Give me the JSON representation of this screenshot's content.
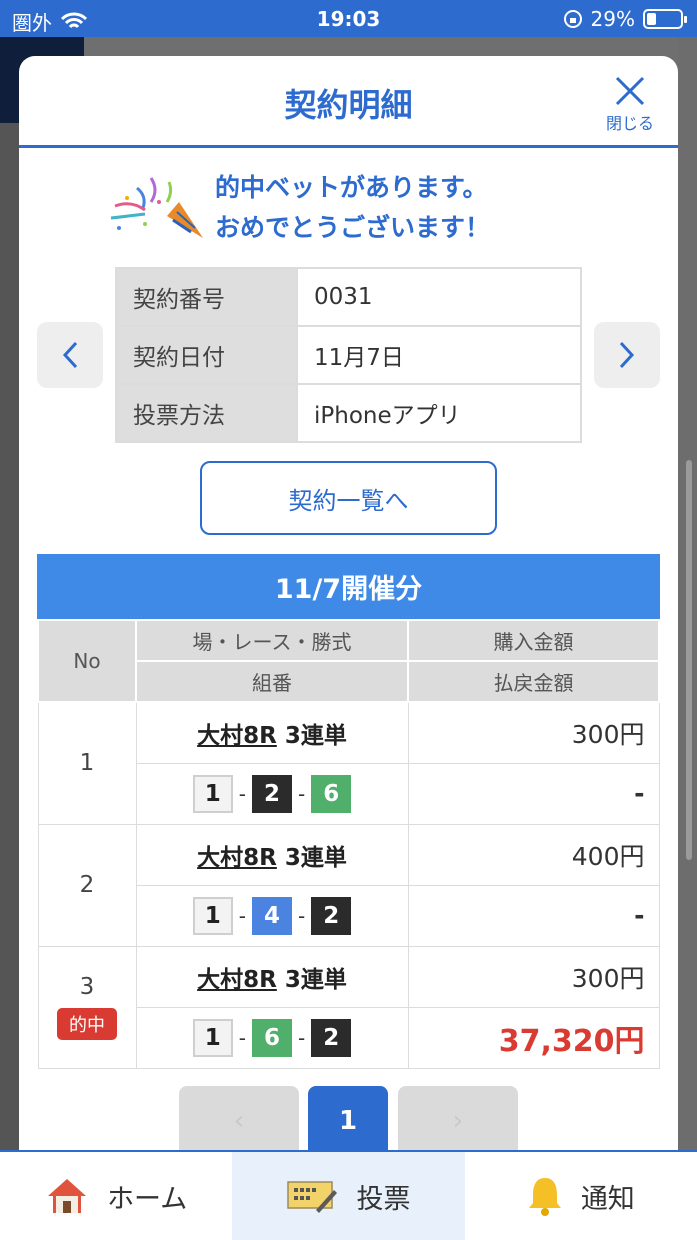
{
  "status_bar": {
    "carrier": "圏外",
    "time": "19:03",
    "battery": "29%",
    "battery_level": 0.29
  },
  "modal": {
    "title": "契約明細",
    "close_label": "閉じる"
  },
  "congrats": {
    "line1": "的中ベットがあります。",
    "line2": "おめでとうございます！"
  },
  "contract": [
    {
      "label": "契約番号",
      "value": "0031"
    },
    {
      "label": "契約日付",
      "value": "11月7日"
    },
    {
      "label": "投票方法",
      "value": "iPhoneアプリ"
    }
  ],
  "list_button": "契約一覧へ",
  "section_title": "11/7開催分",
  "table_headers": {
    "no": "No",
    "race": "場・レース・勝式",
    "combo": "組番",
    "purchase": "購入金額",
    "payout": "払戻金額"
  },
  "bets": [
    {
      "no": "1",
      "venue": "大村8R",
      "type": "3連単",
      "combo": [
        "1",
        "2",
        "6"
      ],
      "amount": "300円",
      "payout": "-",
      "hit": ""
    },
    {
      "no": "2",
      "venue": "大村8R",
      "type": "3連単",
      "combo": [
        "1",
        "4",
        "2"
      ],
      "amount": "400円",
      "payout": "-",
      "hit": ""
    },
    {
      "no": "3",
      "venue": "大村8R",
      "type": "3連単",
      "combo": [
        "1",
        "6",
        "2"
      ],
      "amount": "300円",
      "payout": "37,320円",
      "hit": "的中"
    }
  ],
  "pagination": {
    "prev": "‹",
    "current": "1",
    "next": "›"
  },
  "tabbar": [
    {
      "label": "ホーム",
      "icon": "home-icon"
    },
    {
      "label": "投票",
      "icon": "ticket-icon"
    },
    {
      "label": "通知",
      "icon": "bell-icon"
    }
  ],
  "colors": {
    "primary": "#2d6bcf",
    "section": "#3e8ae6",
    "win": "#d93b32",
    "box1": "#f3f3f3",
    "box2": "#2b2b2b",
    "box4": "#4a84e0",
    "box6": "#4faf6b"
  }
}
